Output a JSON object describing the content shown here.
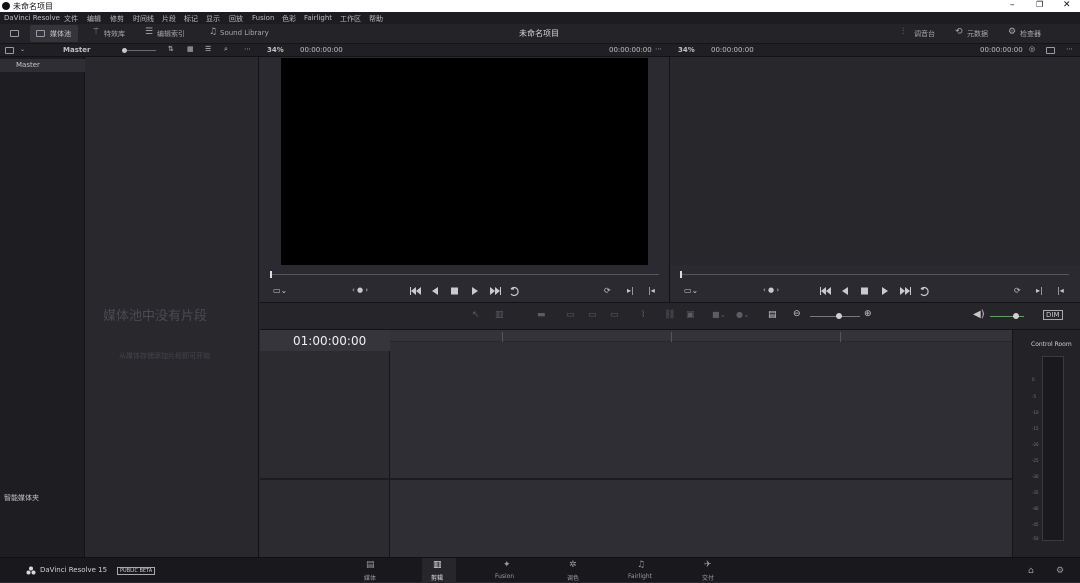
{
  "window": {
    "title": "未命名项目"
  },
  "menu": [
    "DaVinci Resolve",
    "文件",
    "编辑",
    "修剪",
    "时间线",
    "片段",
    "标记",
    "显示",
    "回放",
    "Fusion",
    "色彩",
    "Fairlight",
    "工作区",
    "帮助"
  ],
  "toolbar": {
    "media_pool": "媒体池",
    "effects_library": "特效库",
    "edit_index": "编辑索引",
    "sound_library": "Sound Library",
    "project_title": "未命名项目",
    "mixer": "调音台",
    "metadata": "元数据",
    "inspector": "检查器"
  },
  "media_pool": {
    "bin_label": "Master",
    "tree_root": "Master",
    "empty_title": "媒体池中没有片段",
    "empty_hint": "从媒体存储添加片段即可开始",
    "smart_bins": "智能媒体夹"
  },
  "source_viewer": {
    "zoom": "34%",
    "timecode_left": "00:00:00:00",
    "timecode_right": "00:00:00:00"
  },
  "timeline_viewer": {
    "zoom": "34%",
    "timecode_left": "00:00:00:00",
    "timecode_right": "00:00:00:00"
  },
  "timeline": {
    "timecode": "01:00:00:00",
    "volume_level": 0.75
  },
  "meter": {
    "label": "Control Room",
    "scale": [
      "0",
      "-5",
      "-10",
      "-15",
      "-20",
      "-25",
      "-30",
      "-35",
      "-40",
      "-45",
      "-50"
    ]
  },
  "pages": [
    "媒体",
    "剪辑",
    "Fusion",
    "调色",
    "Fairlight",
    "交付"
  ],
  "active_page": "剪辑",
  "footer": {
    "app_name": "DaVinci Resolve 15",
    "badge": "PUBLIC BETA"
  },
  "colors": {
    "accent_green": "#3fb83f",
    "panel": "#28282e",
    "viewer": "#000000"
  }
}
